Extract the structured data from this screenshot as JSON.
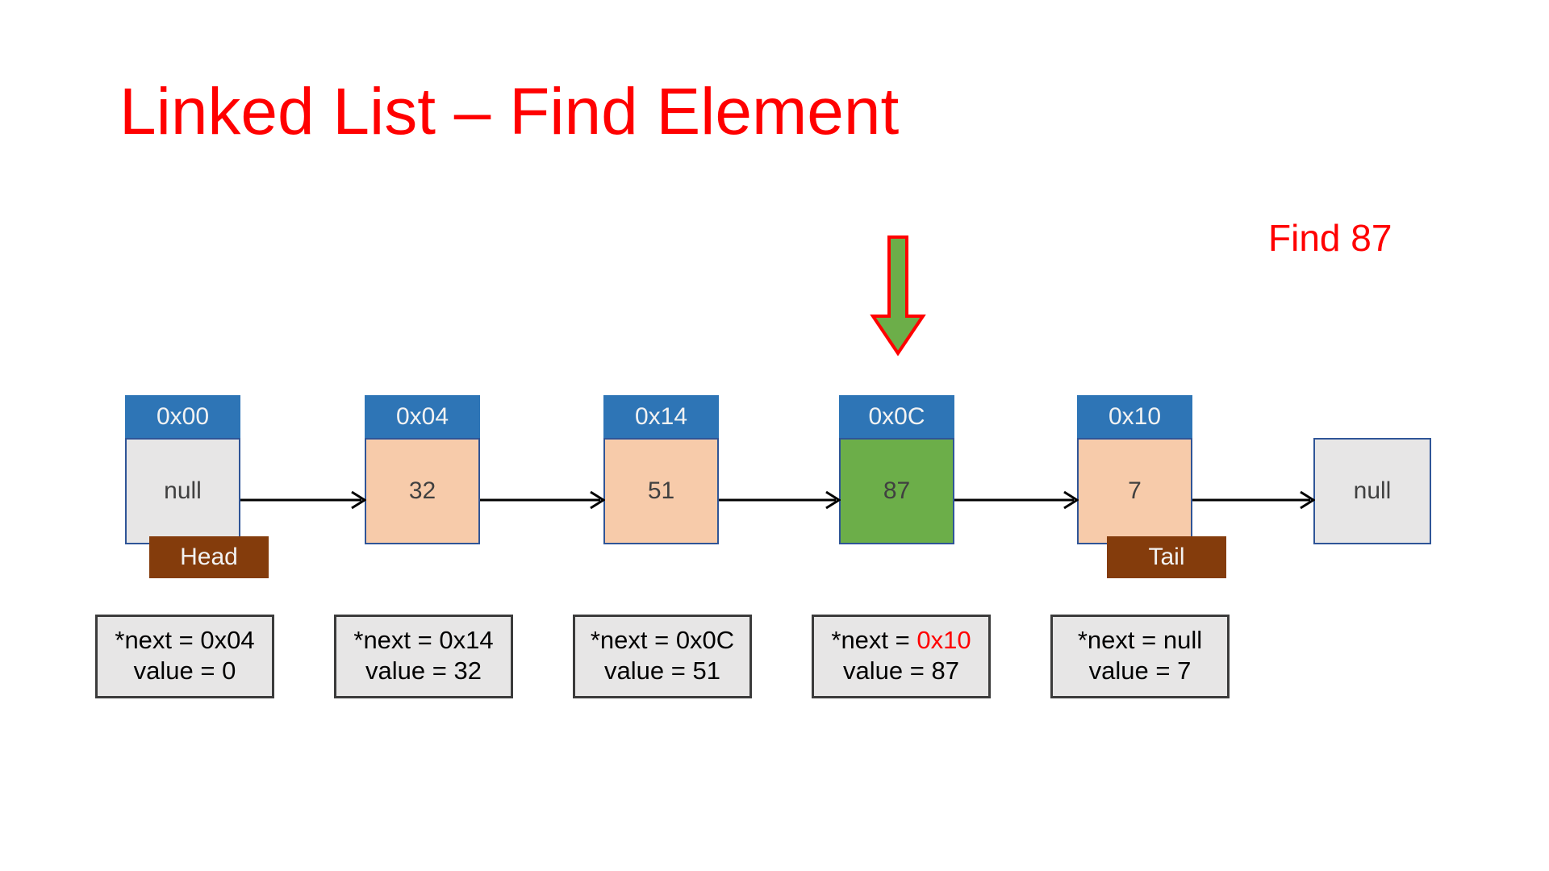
{
  "slide": {
    "title": "Linked List – Find Element",
    "title_color": "#ff0000",
    "find_caption": "Find 87",
    "find_caption_color": "#ff0000",
    "background": "#ffffff"
  },
  "pointer": {
    "icon": "down-arrow-icon",
    "fill": "#6CAE49",
    "stroke": "#ff0000",
    "points_at_address": "0x0C"
  },
  "palette": {
    "address_header": "#2E75B6",
    "node_peach": "#F7CBAA",
    "node_grey": "#E7E6E6",
    "node_highlight_green": "#6CAE49",
    "node_border": "#2F5597",
    "tag_brown": "#843C0C",
    "annotation_bg": "#E7E6E6",
    "annotation_border": "#3B3B3B",
    "highlight_red": "#ff0000"
  },
  "nodes": [
    {
      "address": "0x00",
      "value": "null",
      "fill": "grey",
      "tag": "Head"
    },
    {
      "address": "0x04",
      "value": "32",
      "fill": "peach",
      "tag": ""
    },
    {
      "address": "0x14",
      "value": "51",
      "fill": "peach",
      "tag": ""
    },
    {
      "address": "0x0C",
      "value": "87",
      "fill": "green",
      "tag": ""
    },
    {
      "address": "0x10",
      "value": "7",
      "fill": "peach",
      "tag": "Tail"
    }
  ],
  "terminal": {
    "value": "null"
  },
  "tags": {
    "head": "Head",
    "tail": "Tail"
  },
  "annotations": [
    {
      "next_label": "*next = ",
      "next_value": "0x04",
      "next_highlight": false,
      "value_line": "value = 0"
    },
    {
      "next_label": "*next = ",
      "next_value": "0x14",
      "next_highlight": false,
      "value_line": "value = 32"
    },
    {
      "next_label": "*next = ",
      "next_value": "0x0C",
      "next_highlight": false,
      "value_line": "value = 51"
    },
    {
      "next_label": "*next = ",
      "next_value": "0x10",
      "next_highlight": true,
      "value_line": "value = 87"
    },
    {
      "next_label": "*next = ",
      "next_value": "null",
      "next_highlight": false,
      "value_line": "value = 7"
    }
  ],
  "connectors": [
    {
      "from": "0x00",
      "to": "0x04"
    },
    {
      "from": "0x04",
      "to": "0x14"
    },
    {
      "from": "0x14",
      "to": "0x0C"
    },
    {
      "from": "0x0C",
      "to": "0x10"
    },
    {
      "from": "0x10",
      "to": "terminal-null"
    }
  ]
}
